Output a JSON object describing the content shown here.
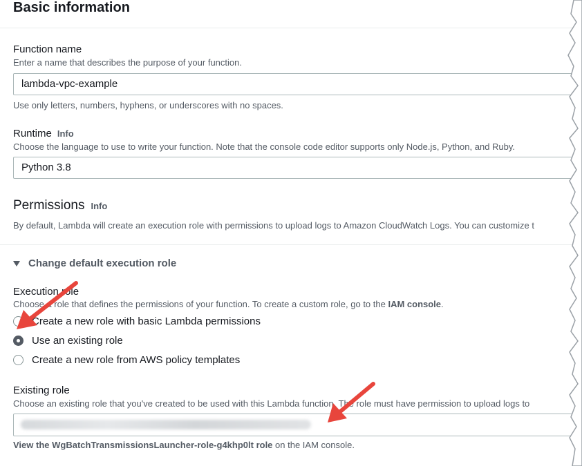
{
  "section_title": "Basic information",
  "function_name": {
    "label": "Function name",
    "description": "Enter a name that describes the purpose of your function.",
    "value": "lambda-vpc-example",
    "hint": "Use only letters, numbers, hyphens, or underscores with no spaces."
  },
  "runtime": {
    "label": "Runtime",
    "info": "Info",
    "description": "Choose the language to use to write your function. Note that the console code editor supports only Node.js, Python, and Ruby.",
    "value": "Python 3.8"
  },
  "permissions": {
    "title": "Permissions",
    "info": "Info",
    "description": "By default, Lambda will create an execution role with permissions to upload logs to Amazon CloudWatch Logs. You can customize t"
  },
  "execution_role_section": {
    "expander_label": "Change default execution role",
    "label": "Execution role",
    "description_prefix": "Choose a role that defines the permissions of your function. To create a custom role, go to the ",
    "iam_console_link": "IAM console",
    "description_suffix": ".",
    "options": [
      {
        "label": "Create a new role with basic Lambda permissions",
        "selected": false
      },
      {
        "label": "Use an existing role",
        "selected": true
      },
      {
        "label": "Create a new role from AWS policy templates",
        "selected": false
      }
    ]
  },
  "existing_role": {
    "label": "Existing role",
    "description": "Choose an existing role that you've created to be used with this Lambda function. The role must have permission to upload logs to",
    "footer_prefix": "View the ",
    "footer_link": "WgBatchTransmissionsLauncher-role-g4khp0lt role",
    "footer_suffix": " on the IAM console."
  },
  "colors": {
    "text": "#16191f",
    "muted": "#545b64",
    "border": "#aab7b8",
    "arrow": "#e8453c"
  },
  "icons": [
    "caret-down-icon",
    "radio-icon",
    "red-arrow-annotation"
  ]
}
